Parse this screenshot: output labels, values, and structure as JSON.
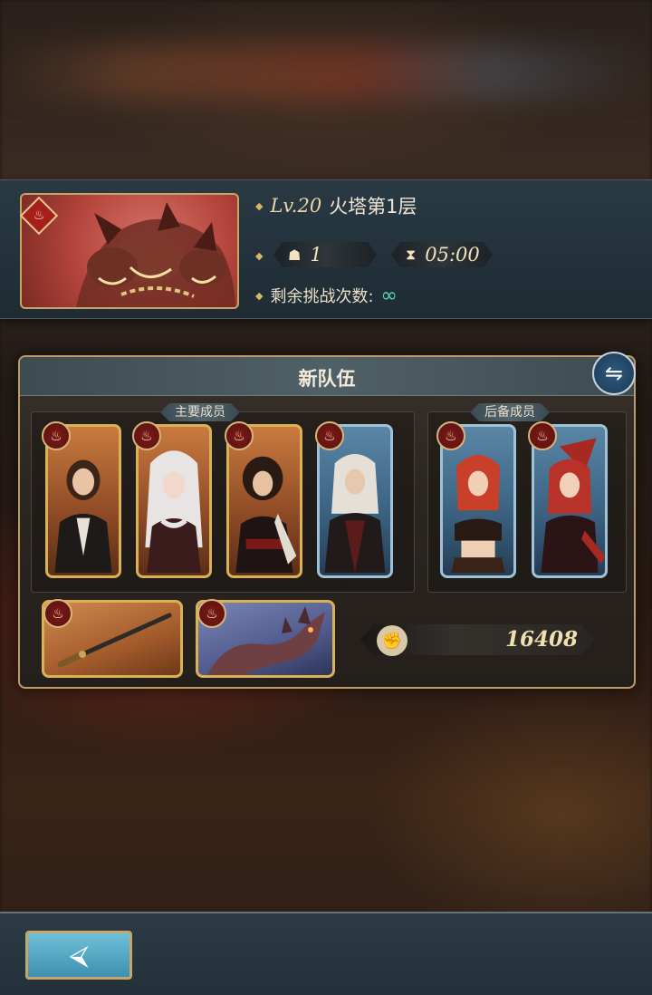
{
  "stage": {
    "level": "Lv.20",
    "name": "火塔第1层",
    "team_size": "1",
    "time_limit": "05:00",
    "remaining_label": "剩余挑战次数:",
    "remaining_value": "∞"
  },
  "team": {
    "title": "新队伍",
    "main_label": "主要成员",
    "backup_label": "后备成员",
    "power": "16408"
  },
  "icons": {
    "element": "fire-element-icon",
    "swap": "swap-icon",
    "back": "back-arrow-icon"
  },
  "colors": {
    "gold_frame": "#d9b256",
    "silver_frame": "#9fc2d6",
    "fire_badge": "#a61f1c",
    "infinity": "#5fd6b1"
  }
}
